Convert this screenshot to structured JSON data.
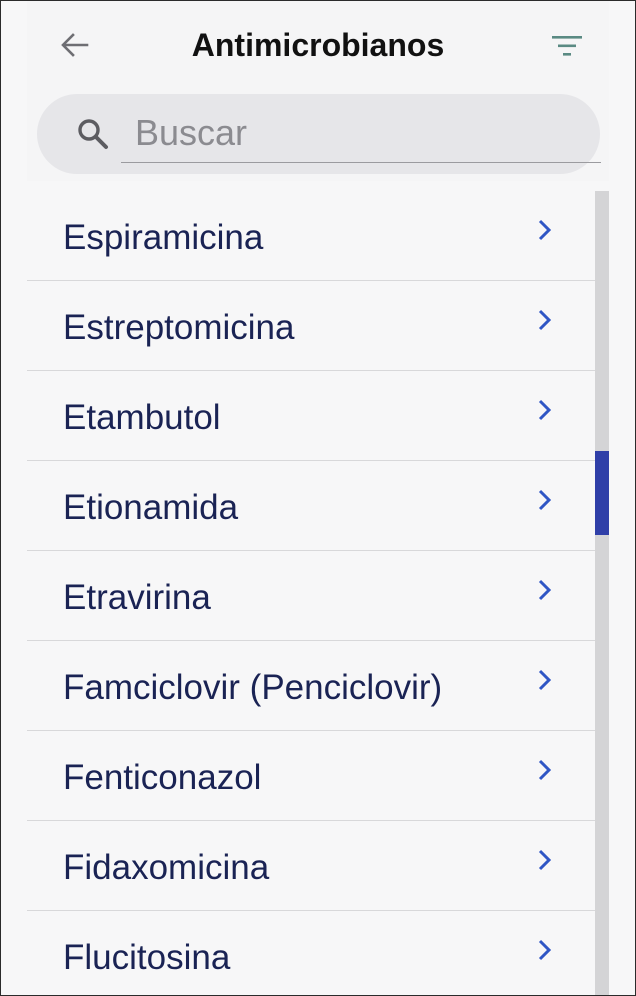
{
  "header": {
    "title": "Antimicrobianos",
    "back_icon": "arrow-left-icon",
    "filter_icon": "filter-icon"
  },
  "search": {
    "placeholder": "Buscar",
    "value": "",
    "icon": "search-icon"
  },
  "list": {
    "items": [
      {
        "label": "Espiramicina"
      },
      {
        "label": "Estreptomicina"
      },
      {
        "label": "Etambutol"
      },
      {
        "label": "Etionamida"
      },
      {
        "label": "Etravirina"
      },
      {
        "label": "Famciclovir (Penciclovir)"
      },
      {
        "label": "Fenticonazol"
      },
      {
        "label": "Fidaxomicina"
      },
      {
        "label": "Flucitosina"
      }
    ],
    "item_icon": "chevron-right-icon"
  },
  "scrollbar": {
    "position_fraction": 0.36
  },
  "colors": {
    "accent": "#2f3fa8",
    "chevron": "#2f56c5",
    "text": "#1a2354",
    "icon_gray": "#6e6e73",
    "filter_teal": "#5a8a83",
    "background": "#f7f7f8",
    "search_bg": "#e6e6e9"
  }
}
